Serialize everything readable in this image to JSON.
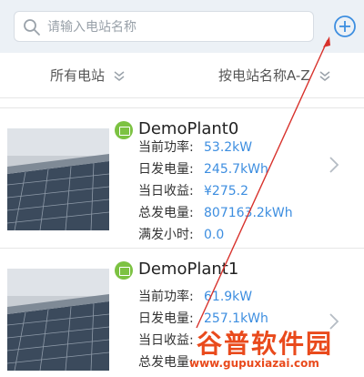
{
  "search": {
    "placeholder": "请输入电站名称"
  },
  "filters": {
    "all_stations": "所有电站",
    "sort_by": "按电站名称A-Z"
  },
  "stations": [
    {
      "name": "DemoPlant0",
      "rows": [
        {
          "label": "当前功率:",
          "value": "53.2kW"
        },
        {
          "label": "日发电量:",
          "value": "245.7kWh"
        },
        {
          "label": "当日收益:",
          "value": "¥275.2"
        },
        {
          "label": "总发电量:",
          "value": "807163.2kWh"
        },
        {
          "label": "满发小时:",
          "value": "0.0"
        }
      ]
    },
    {
      "name": "DemoPlant1",
      "rows": [
        {
          "label": "当前功率:",
          "value": "61.9kW"
        },
        {
          "label": "日发电量:",
          "value": "257.1kWh"
        },
        {
          "label": "当日收益:",
          "value": ""
        },
        {
          "label": "总发电量:",
          "value": ""
        }
      ]
    }
  ],
  "watermark": {
    "title": "谷普软件园",
    "url": "www.gupuxiazai.com"
  },
  "colors": {
    "accent": "#3d8ee0",
    "badge": "#7cc242",
    "watermark": "#e94a1c",
    "annotation": "#d8322c"
  },
  "icons": {
    "search": "search-icon",
    "add": "plus-circle-icon",
    "chevron": "chevron-down-icon",
    "arrow": "chevron-right-icon",
    "station": "station-icon"
  }
}
